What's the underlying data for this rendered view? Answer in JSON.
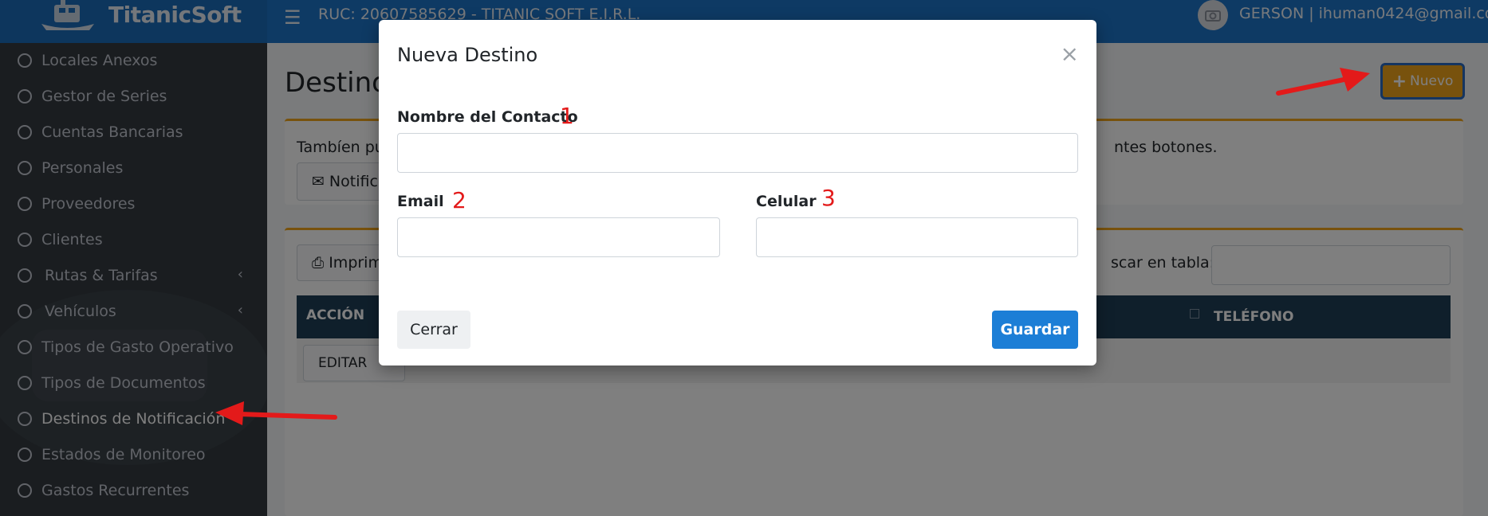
{
  "navbar": {
    "brand": "TitanicSoft",
    "ruc": "RUC: 20607585629 - TITANIC SOFT E.I.R.L.",
    "user": "GERSON | ihuman0424@gmail.com"
  },
  "sidebar": {
    "items": [
      {
        "label": "Locales Anexos"
      },
      {
        "label": "Gestor de Series"
      },
      {
        "label": "Cuentas Bancarias"
      },
      {
        "label": "Personales"
      },
      {
        "label": "Proveedores"
      },
      {
        "label": "Clientes"
      },
      {
        "label": "Rutas & Tarifas",
        "has_submenu": true
      },
      {
        "label": "Vehículos",
        "has_submenu": true
      },
      {
        "label": "Tipos de Gasto Operativo"
      },
      {
        "label": "Tipos de Documentos"
      },
      {
        "label": "Destinos de Notificación",
        "active": true
      },
      {
        "label": "Estados de Monitoreo"
      },
      {
        "label": "Gastos Recurrentes"
      }
    ]
  },
  "main": {
    "title": "Destinos",
    "nuevo_label": "Nuevo",
    "info_left": "Tambíen pu",
    "info_right": "ntes botones.",
    "notif_label": "Notifica",
    "print_label": "Imprim",
    "search_label": "scar en tabla:",
    "table": {
      "col_accion": "ACCIÓN",
      "col_telefono": "TELÉFONO",
      "row_action": "EDITAR"
    }
  },
  "modal": {
    "title": "Nueva Destino",
    "close": "×",
    "fields": {
      "nombre": {
        "label": "Nombre del Contacto",
        "marker": "1",
        "value": ""
      },
      "email": {
        "label": "Email",
        "marker": "2",
        "value": ""
      },
      "celular": {
        "label": "Celular",
        "marker": "3",
        "value": ""
      }
    },
    "cerrar_label": "Cerrar",
    "guardar_label": "Guardar"
  },
  "colors": {
    "navbar": "#1d75c9",
    "sidebar": "#343a40",
    "accent": "#f0a51a",
    "primary_button": "#1c7ed6",
    "annotation": "#e31a1a"
  }
}
